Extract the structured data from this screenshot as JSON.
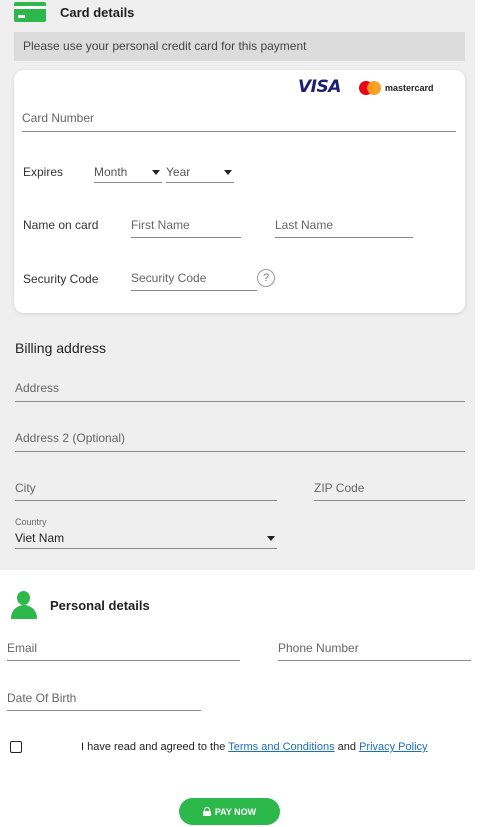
{
  "card_section": {
    "title": "Card details",
    "icon": "credit-card-icon",
    "notice": "Please use your personal credit card for this payment",
    "brands": {
      "visa": "VISA",
      "mastercard": "mastercard"
    },
    "card_number_placeholder": "Card Number",
    "expires_label": "Expires",
    "month_value": "Month",
    "year_value": "Year",
    "name_label": "Name on card",
    "first_name_placeholder": "First Name",
    "last_name_placeholder": "Last Name",
    "security_label": "Security Code",
    "security_placeholder": "Security Code",
    "help_symbol": "?"
  },
  "billing": {
    "title": "Billing address",
    "address_placeholder": "Address",
    "address2_placeholder": "Address 2 (Optional)",
    "city_placeholder": "City",
    "zip_placeholder": "ZIP Code",
    "country_label": "Country",
    "country_value": "Viet Nam"
  },
  "personal": {
    "title": "Personal details",
    "icon": "user-icon",
    "email_placeholder": "Email",
    "phone_placeholder": "Phone Number",
    "dob_placeholder": "Date Of Birth"
  },
  "agreement": {
    "prefix": "I have read and agreed to the ",
    "terms_link": "Terms and Conditions",
    "middle": " and ",
    "privacy_link": "Privacy Policy",
    "checked": false
  },
  "pay_button": {
    "label": "PAY NOW",
    "icon": "lock-icon"
  },
  "colors": {
    "accent": "#2db84b",
    "link": "#1a6ec0",
    "section_bg": "#efefef",
    "notice_bg": "#dcdcdc"
  }
}
